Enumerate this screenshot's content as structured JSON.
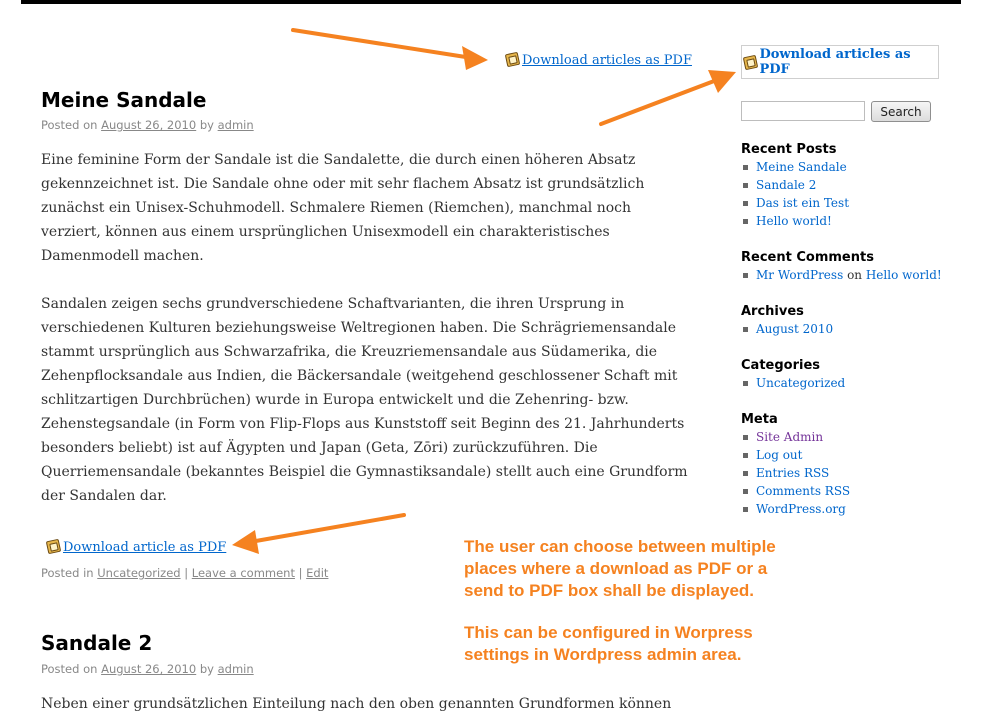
{
  "top_pdf_link": "Download articles as PDF",
  "sidebar": {
    "pdf_box_link": "Download articles as PDF",
    "search_button": "Search",
    "search_placeholder": "",
    "recent_posts": {
      "title": "Recent Posts",
      "items": [
        "Meine Sandale",
        "Sandale 2",
        "Das ist ein Test",
        "Hello world!"
      ]
    },
    "recent_comments": {
      "title": "Recent Comments",
      "author": "Mr WordPress",
      "on": "on",
      "post": "Hello world!"
    },
    "archives": {
      "title": "Archives",
      "items": [
        "August 2010"
      ]
    },
    "categories": {
      "title": "Categories",
      "items": [
        "Uncategorized"
      ]
    },
    "meta": {
      "title": "Meta",
      "items": [
        "Site Admin",
        "Log out",
        "Entries RSS",
        "Comments RSS",
        "WordPress.org"
      ]
    }
  },
  "posts": [
    {
      "title": "Meine Sandale",
      "posted_on": "Posted on",
      "date": "August 26, 2010",
      "by": "by",
      "author": "admin",
      "paragraphs": [
        "Eine feminine Form der Sandale ist die Sandalette, die durch einen höheren Absatz gekennzeichnet ist. Die Sandale ohne oder mit sehr flachem Absatz ist grundsätzlich zunächst ein Unisex-Schuhmodell. Schmalere Riemen (Riemchen), manchmal noch verziert, können aus einem ursprünglichen Unisexmodell ein charakteristisches Damenmodell machen.",
        "Sandalen zeigen sechs grundverschiedene Schaftvarianten, die ihren Ursprung in verschiedenen Kulturen beziehungsweise Weltregionen haben. Die Schrägriemensandale stammt ursprünglich aus Schwarzafrika, die Kreuzriemensandale aus Südamerika, die Zehenpflocksandale aus Indien, die Bäckersandale (weitgehend geschlossener Schaft mit schlitzartigen Durchbrüchen) wurde in Europa entwickelt und die Zehenring- bzw. Zehenstegsandale (in Form von Flip-Flops aus Kunststoff seit Beginn des 21. Jahrhunderts besonders beliebt) ist auf Ägypten und Japan (Geta, Zōri) zurückzuführen. Die Querriemensandale (bekanntes Beispiel die Gymnastiksandale) stellt auch eine Grundform der Sandalen dar."
      ],
      "pdf_link": "Download article as PDF",
      "footer": {
        "posted_in": "Posted in",
        "category": "Uncategorized",
        "sep1": "|",
        "leave_comment": "Leave a comment",
        "sep2": "|",
        "edit": "Edit"
      }
    },
    {
      "title": "Sandale 2",
      "posted_on": "Posted on",
      "date": "August 26, 2010",
      "by": "by",
      "author": "admin",
      "excerpt": "Neben einer grundsätzlichen Einteilung nach den oben genannten Grundformen können"
    }
  ],
  "annotation": {
    "line1": "The user can choose between multiple",
    "line2": "places where a download as PDF or a",
    "line3": "send to PDF box shall be displayed.",
    "line4": "This can be configured in Worpress",
    "line5": "settings in Wordpress admin area."
  },
  "colors": {
    "accent_orange": "#f58220",
    "link_blue": "#0066cc",
    "visited_purple": "#743399"
  }
}
